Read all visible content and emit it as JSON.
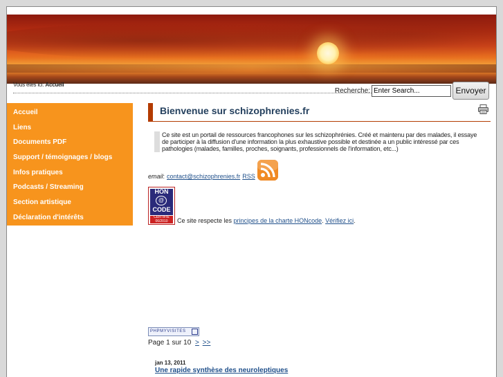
{
  "breadcrumb": {
    "prefix": "Vous êtes ici:",
    "current": "Accueil"
  },
  "search": {
    "label": "Recherche:",
    "value": "Enter Search...",
    "button": "Envoyer"
  },
  "sidebar": {
    "items": [
      {
        "label": "Accueil"
      },
      {
        "label": "Liens"
      },
      {
        "label": "Documents PDF"
      },
      {
        "label": "Support / témoignages / blogs"
      },
      {
        "label": "Infos pratiques"
      },
      {
        "label": "Podcasts / Streaming"
      },
      {
        "label": "Section artistique"
      },
      {
        "label": "Déclaration d'intérêts"
      }
    ]
  },
  "main": {
    "title": "Bienvenue sur schizophrenies.fr",
    "intro": "Ce site est un portail de ressources francophones sur les schizophrénies. Créé et maintenu par des malades, il essaye de participer à la diffusion d'une information la plus exhaustive possible et destinée a un public intéressé par ces pathologies (malades, familles, proches, soignants, professionnels de l'information, etc...)",
    "email_label": "email",
    "email_sep": " :",
    "email": "contact@schizophrenies.fr",
    "rss": "RSS",
    "hon": {
      "badge_top": "HON",
      "badge_mid": "@",
      "badge_code": "CODE",
      "badge_cert": "CERTIFIE 06/2010",
      "text_before": "Ce site respecte les ",
      "link1": "principes de la charte HONcode",
      "text_mid": ". ",
      "link2": "Vérifiez ici",
      "text_after": "."
    }
  },
  "phpmv": {
    "label": "PHPMYVISITES"
  },
  "pager": {
    "text": "Page  1 sur 10",
    "next": ">",
    "last": ">>"
  },
  "post": {
    "date": "jan 13, 2011",
    "title": "Une rapide synthèse des neuroleptiques"
  }
}
